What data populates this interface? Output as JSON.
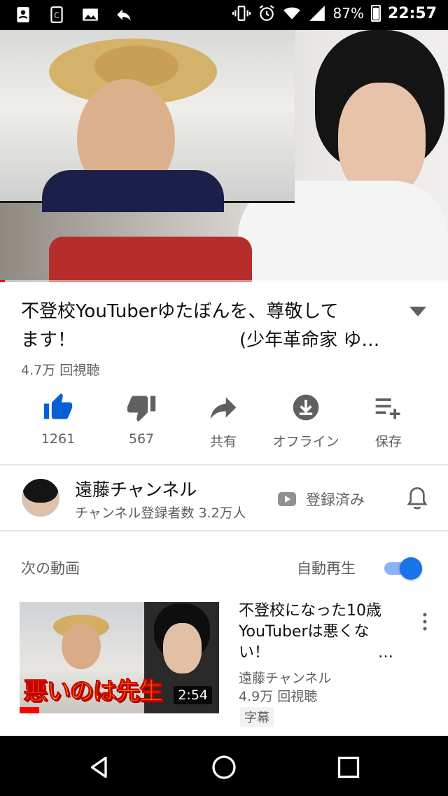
{
  "status_bar": {
    "battery": "87%",
    "time": "22:57"
  },
  "video": {
    "progress": 0.011
  },
  "title": {
    "line1": "不登校YouTuberゆたぼんを、尊敬して",
    "line2": "ます！　　　　　　　　　(少年革命家 ゆ…"
  },
  "views": "4.7万 回視聴",
  "actions": {
    "like": "1261",
    "dislike": "567",
    "share": "共有",
    "offline": "オフライン",
    "save": "保存"
  },
  "channel": {
    "name": "遠藤チャンネル",
    "subs": "チャンネル登録者数 3.2万人",
    "subscribed": "登録済み"
  },
  "up_next": {
    "label": "次の動画",
    "autoplay": "自動再生",
    "autoplay_on": true
  },
  "next_video": {
    "title": "不登校になった10歳YouTuberは悪くない！",
    "ellipsis": "…",
    "channel": "遠藤チャンネル",
    "views": "4.9万 回視聴",
    "badge": "字幕",
    "duration": "2:54",
    "thumb_caption": "悪いのは先生"
  },
  "colors": {
    "like_active": "#065fd4",
    "toggle": "#1a73e8",
    "progress": "#ff0000"
  }
}
